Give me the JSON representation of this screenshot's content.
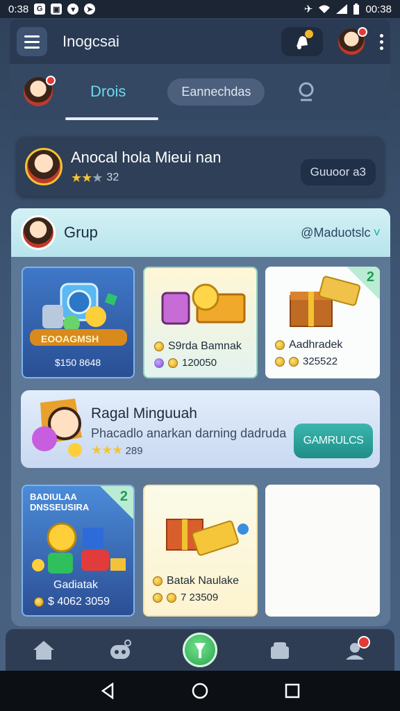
{
  "status_bar": {
    "time_left": "0:38",
    "time_right": "00:38"
  },
  "app_bar": {
    "title": "Inogcsai"
  },
  "tabs": {
    "active": "Drois",
    "pill": "Eannechdas"
  },
  "profile": {
    "name": "Anocal hola Mieui nan",
    "rating": 3,
    "score": "32",
    "button": "Guuoor a3"
  },
  "group": {
    "title": "Grup",
    "link": "@Maduotslc",
    "chevron": "˅"
  },
  "cards": [
    {
      "id": "card-1",
      "banner": "EOOAGMSH",
      "value": "$150 8648",
      "dark": true
    },
    {
      "id": "card-2",
      "label": "S9rda Bamnak",
      "value": "120050"
    },
    {
      "id": "card-3",
      "label": "Aadhradek",
      "value": "325522",
      "badge": "2"
    },
    {
      "id": "card-4",
      "top_text": "BADIULAA DNSSEUSIRA",
      "label": "Gadiatak",
      "value": "$ 4062 3059",
      "badge": "2",
      "dark": true
    },
    {
      "id": "card-5",
      "label": "Batak Naulake",
      "value": "7 23509"
    },
    {
      "id": "card-6"
    }
  ],
  "banner": {
    "title": "Ragal Minguuah",
    "subtitle": "Phacadlo anarkan darning dadruda",
    "rating": 3,
    "score": "289",
    "button": "GAMRULCS"
  },
  "icons": {
    "status_left": [
      "g-icon",
      "image-icon",
      "shield-icon",
      "navigation-icon"
    ],
    "status_right": [
      "airplane-icon",
      "wifi-icon",
      "signal-icon",
      "battery-icon"
    ],
    "nav": [
      "home-icon",
      "chat-bot-icon",
      "pin-icon",
      "store-icon",
      "profile-icon"
    ]
  },
  "colors": {
    "accent": "#6fd6ef",
    "teal_button": "#1f8e87",
    "badge_red": "#e53935",
    "coin_gold": "#f4c430"
  }
}
